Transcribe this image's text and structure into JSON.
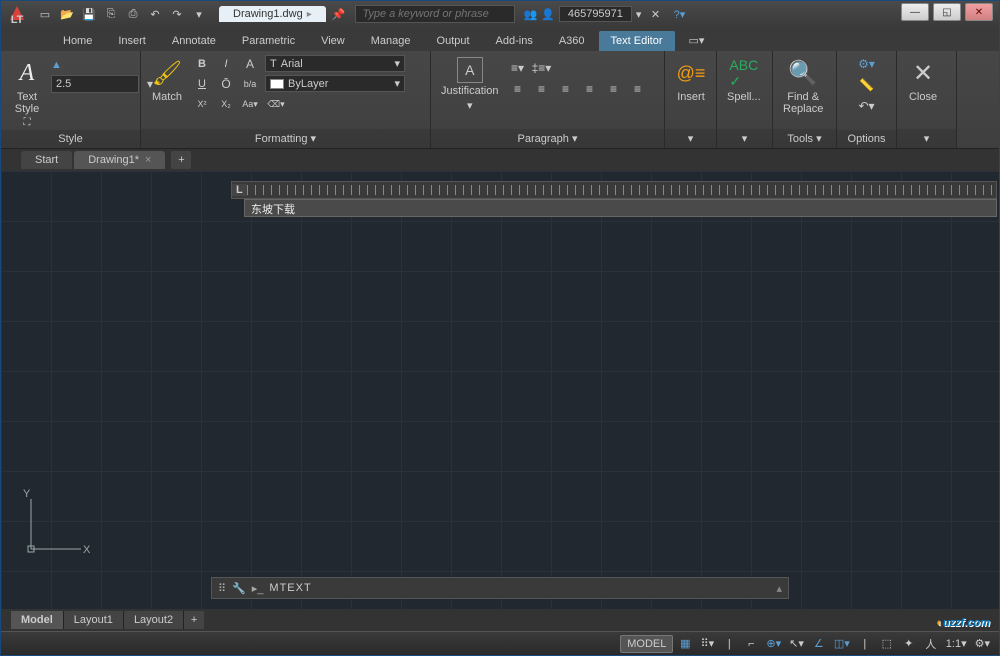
{
  "title_file": "Drawing1.dwg",
  "search_placeholder": "Type a keyword or phrase",
  "user_id": "465795971",
  "ribbon_tabs": [
    "Home",
    "Insert",
    "Annotate",
    "Parametric",
    "View",
    "Manage",
    "Output",
    "Add-ins",
    "A360",
    "Text Editor"
  ],
  "active_ribbon_tab": "Text Editor",
  "panels": {
    "style": {
      "title": "Style",
      "text_btn": "Text\nStyle",
      "height": "2.5"
    },
    "formatting": {
      "title": "Formatting  ▾",
      "match": "Match",
      "font": "Arial",
      "layer": "ByLayer"
    },
    "paragraph": {
      "title": "Paragraph  ▾",
      "just": "Justification"
    },
    "insert": {
      "title": "▾",
      "btn": "Insert"
    },
    "spell": {
      "title": "▾",
      "btn": "Spell..."
    },
    "tools": {
      "title": "Tools ▾",
      "btn": "Find &\nReplace"
    },
    "options": {
      "title": "Options"
    },
    "close": {
      "title": "▾",
      "btn": "Close"
    }
  },
  "doc_tabs": {
    "start": "Start",
    "drawing": "Drawing1*"
  },
  "text_content": "东坡下载",
  "axes": {
    "x": "X",
    "y": "Y"
  },
  "cmd": "MTEXT",
  "layout_tabs": [
    "Model",
    "Layout1",
    "Layout2"
  ],
  "status": {
    "model": "MODEL",
    "scale": "1:1"
  },
  "watermark": "uzzf.com"
}
